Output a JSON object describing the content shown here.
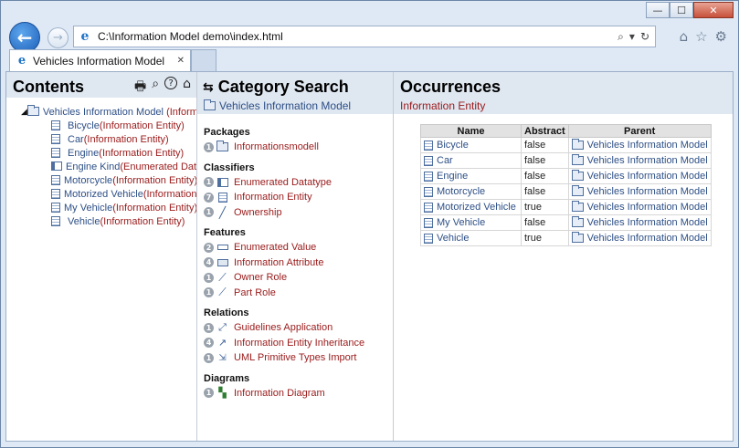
{
  "window": {
    "minimize": "—",
    "maximize": "☐",
    "close": "✕"
  },
  "nav": {
    "back_glyph": "←",
    "forward_glyph": "→",
    "url": "C:\\Information Model demo\\index.html",
    "addr_search": "⌕",
    "addr_drop": "▾",
    "addr_refresh": "↻",
    "home_glyph": "⌂",
    "fav_glyph": "☆",
    "tools_glyph": "⚙"
  },
  "tab": {
    "label": "Vehicles Information Model",
    "close": "✕",
    "ie_glyph": "e"
  },
  "contents": {
    "title": "Contents",
    "tool_print": "🖶",
    "tool_search": "⌕",
    "tool_help": "?",
    "tool_home": "⌂",
    "root": {
      "name": "Vehicles Information Model",
      "type": "Information Model",
      "toggle": "◢"
    },
    "items": [
      {
        "name": "Bicycle",
        "type": "Information Entity",
        "icon": "entity-icon"
      },
      {
        "name": "Car",
        "type": "Information Entity",
        "icon": "entity-icon"
      },
      {
        "name": "Engine",
        "type": "Information Entity",
        "icon": "entity-icon"
      },
      {
        "name": "Engine Kind",
        "type": "Enumerated Datatype",
        "icon": "enum-icon"
      },
      {
        "name": "Motorcycle",
        "type": "Information Entity",
        "icon": "entity-icon"
      },
      {
        "name": "Motorized Vehicle",
        "type": "Information Entity",
        "icon": "entity-icon"
      },
      {
        "name": "My Vehicle",
        "type": "Information Entity",
        "icon": "entity-icon"
      },
      {
        "name": "Vehicle",
        "type": "Information Entity",
        "icon": "entity-icon"
      }
    ]
  },
  "category": {
    "title": "Category Search",
    "title_glyph": "⇆",
    "subtitle": "Vehicles Information Model",
    "sections": [
      {
        "heading": "Packages",
        "rows": [
          {
            "count": "1",
            "label": "Informationsmodell",
            "icon": "package-icon"
          }
        ]
      },
      {
        "heading": "Classifiers",
        "rows": [
          {
            "count": "1",
            "label": "Enumerated Datatype",
            "icon": "enum-icon"
          },
          {
            "count": "7",
            "label": "Information Entity",
            "icon": "entity-icon"
          },
          {
            "count": "1",
            "label": "Ownership",
            "icon": "ownership-icon"
          }
        ]
      },
      {
        "heading": "Features",
        "rows": [
          {
            "count": "2",
            "label": "Enumerated Value",
            "icon": "enum-value-icon"
          },
          {
            "count": "4",
            "label": "Information Attribute",
            "icon": "attribute-icon"
          },
          {
            "count": "1",
            "label": "Owner Role",
            "icon": "role-icon"
          },
          {
            "count": "1",
            "label": "Part Role",
            "icon": "role-icon"
          }
        ]
      },
      {
        "heading": "Relations",
        "rows": [
          {
            "count": "1",
            "label": "Guidelines Application",
            "icon": "dependency-icon"
          },
          {
            "count": "4",
            "label": "Information Entity Inheritance",
            "icon": "inheritance-icon"
          },
          {
            "count": "1",
            "label": "UML Primitive Types Import",
            "icon": "import-icon"
          }
        ]
      },
      {
        "heading": "Diagrams",
        "rows": [
          {
            "count": "1",
            "label": "Information Diagram",
            "icon": "diagram-icon"
          }
        ]
      }
    ]
  },
  "occurrences": {
    "title": "Occurrences",
    "subtitle": "Information Entity",
    "columns": [
      "Name",
      "Abstract",
      "Parent"
    ],
    "rows": [
      {
        "name": "Bicycle",
        "abstract": "false",
        "parent": "Vehicles Information Model"
      },
      {
        "name": "Car",
        "abstract": "false",
        "parent": "Vehicles Information Model"
      },
      {
        "name": "Engine",
        "abstract": "false",
        "parent": "Vehicles Information Model"
      },
      {
        "name": "Motorcycle",
        "abstract": "false",
        "parent": "Vehicles Information Model"
      },
      {
        "name": "Motorized Vehicle",
        "abstract": "true",
        "parent": "Vehicles Information Model"
      },
      {
        "name": "My Vehicle",
        "abstract": "false",
        "parent": "Vehicles Information Model"
      },
      {
        "name": "Vehicle",
        "abstract": "true",
        "parent": "Vehicles Information Model"
      }
    ]
  }
}
